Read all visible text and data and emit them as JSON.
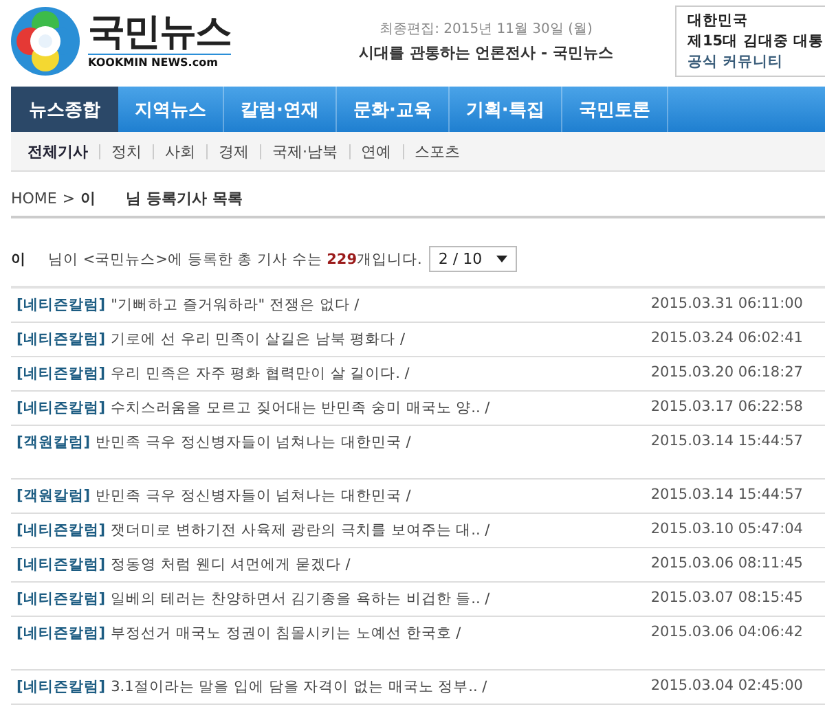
{
  "header": {
    "logo_title": "국민뉴스",
    "logo_subtitle": "KOOKMIN NEWS.com",
    "edit_date": "최종편집: 2015년 11월 30일 (월)",
    "slogan": "시대를 관통하는 언론전사 - 국민뉴스",
    "banner_lines": [
      "대한민국",
      "제15대 김대중 대통",
      "공식 커뮤니티"
    ]
  },
  "nav": [
    {
      "label": "뉴스종합",
      "selected": true
    },
    {
      "label": "지역뉴스",
      "selected": false
    },
    {
      "label": "칼럼·연재",
      "selected": false
    },
    {
      "label": "문화·교육",
      "selected": false
    },
    {
      "label": "기획·특집",
      "selected": false
    },
    {
      "label": "국민토론",
      "selected": false
    }
  ],
  "subnav": [
    {
      "label": "전체기사",
      "selected": true
    },
    {
      "label": "정치",
      "selected": false
    },
    {
      "label": "사회",
      "selected": false
    },
    {
      "label": "경제",
      "selected": false
    },
    {
      "label": "국제·남북",
      "selected": false
    },
    {
      "label": "연예",
      "selected": false
    },
    {
      "label": "스포츠",
      "selected": false
    }
  ],
  "breadcrumb": {
    "home": "HOME",
    "separator": ">",
    "name": "이",
    "title": "님 등록기사 목록"
  },
  "summary": {
    "name": "이",
    "text": "님이 <국민뉴스>에 등록한 총 기사 수는 **229**개입니다.",
    "page_select": "2 / 10"
  },
  "articles": [
    {
      "kind": "normal",
      "category": "[네티즌칼럼]",
      "title": "\"기뻐하고 즐거워하라\" 전쟁은 없다 /",
      "date": "2015.03.31 06:11:00"
    },
    {
      "kind": "normal",
      "category": "[네티즌칼럼]",
      "title": "기로에 선 우리 민족이 살길은 남북 평화다 /",
      "date": "2015.03.24 06:02:41"
    },
    {
      "kind": "normal",
      "category": "[네티즌칼럼]",
      "title": "우리 민족은 자주 평화 협력만이 살 길이다. /",
      "date": "2015.03.20 06:18:27"
    },
    {
      "kind": "normal",
      "category": "[네티즌칼럼]",
      "title": "수치스러움을 모르고 짖어대는 반민족 숭미 매국노 양.. /",
      "date": "2015.03.17 06:22:58"
    },
    {
      "kind": "tall",
      "category": "[객원칼럼]",
      "title": "반민족 극우 정신병자들이 넘쳐나는 대한민국 /",
      "date": "2015.03.14 15:44:57"
    },
    {
      "kind": "normal",
      "category": "[객원칼럼]",
      "title": "반민족 극우 정신병자들이 넘쳐나는 대한민국 /",
      "date": "2015.03.14 15:44:57"
    },
    {
      "kind": "normal",
      "category": "[네티즌칼럼]",
      "title": "잿더미로 변하기전 사육제 광란의 극치를 보여주는 대.. /",
      "date": "2015.03.10 05:47:04"
    },
    {
      "kind": "normal",
      "category": "[네티즌칼럼]",
      "title": "정동영 처럼 웬디 셔먼에게 묻겠다 /",
      "date": "2015.03.06 08:11:45"
    },
    {
      "kind": "normal",
      "category": "[네티즌칼럼]",
      "title": "일베의 테러는 찬양하면서 김기종을 욕하는 비겁한 들.. /",
      "date": "2015.03.07 08:15:45"
    },
    {
      "kind": "tall",
      "category": "[네티즌칼럼]",
      "title": "부정선거 매국노 정권이 침몰시키는 노예선 한국호 /",
      "date": "2015.03.06 04:06:42"
    },
    {
      "kind": "normal",
      "category": "[네티즌칼럼]",
      "title": "3.1절이라는 말을 입에 담을 자격이 없는 매국노 정부.. /",
      "date": "2015.03.04 02:45:00"
    }
  ]
}
